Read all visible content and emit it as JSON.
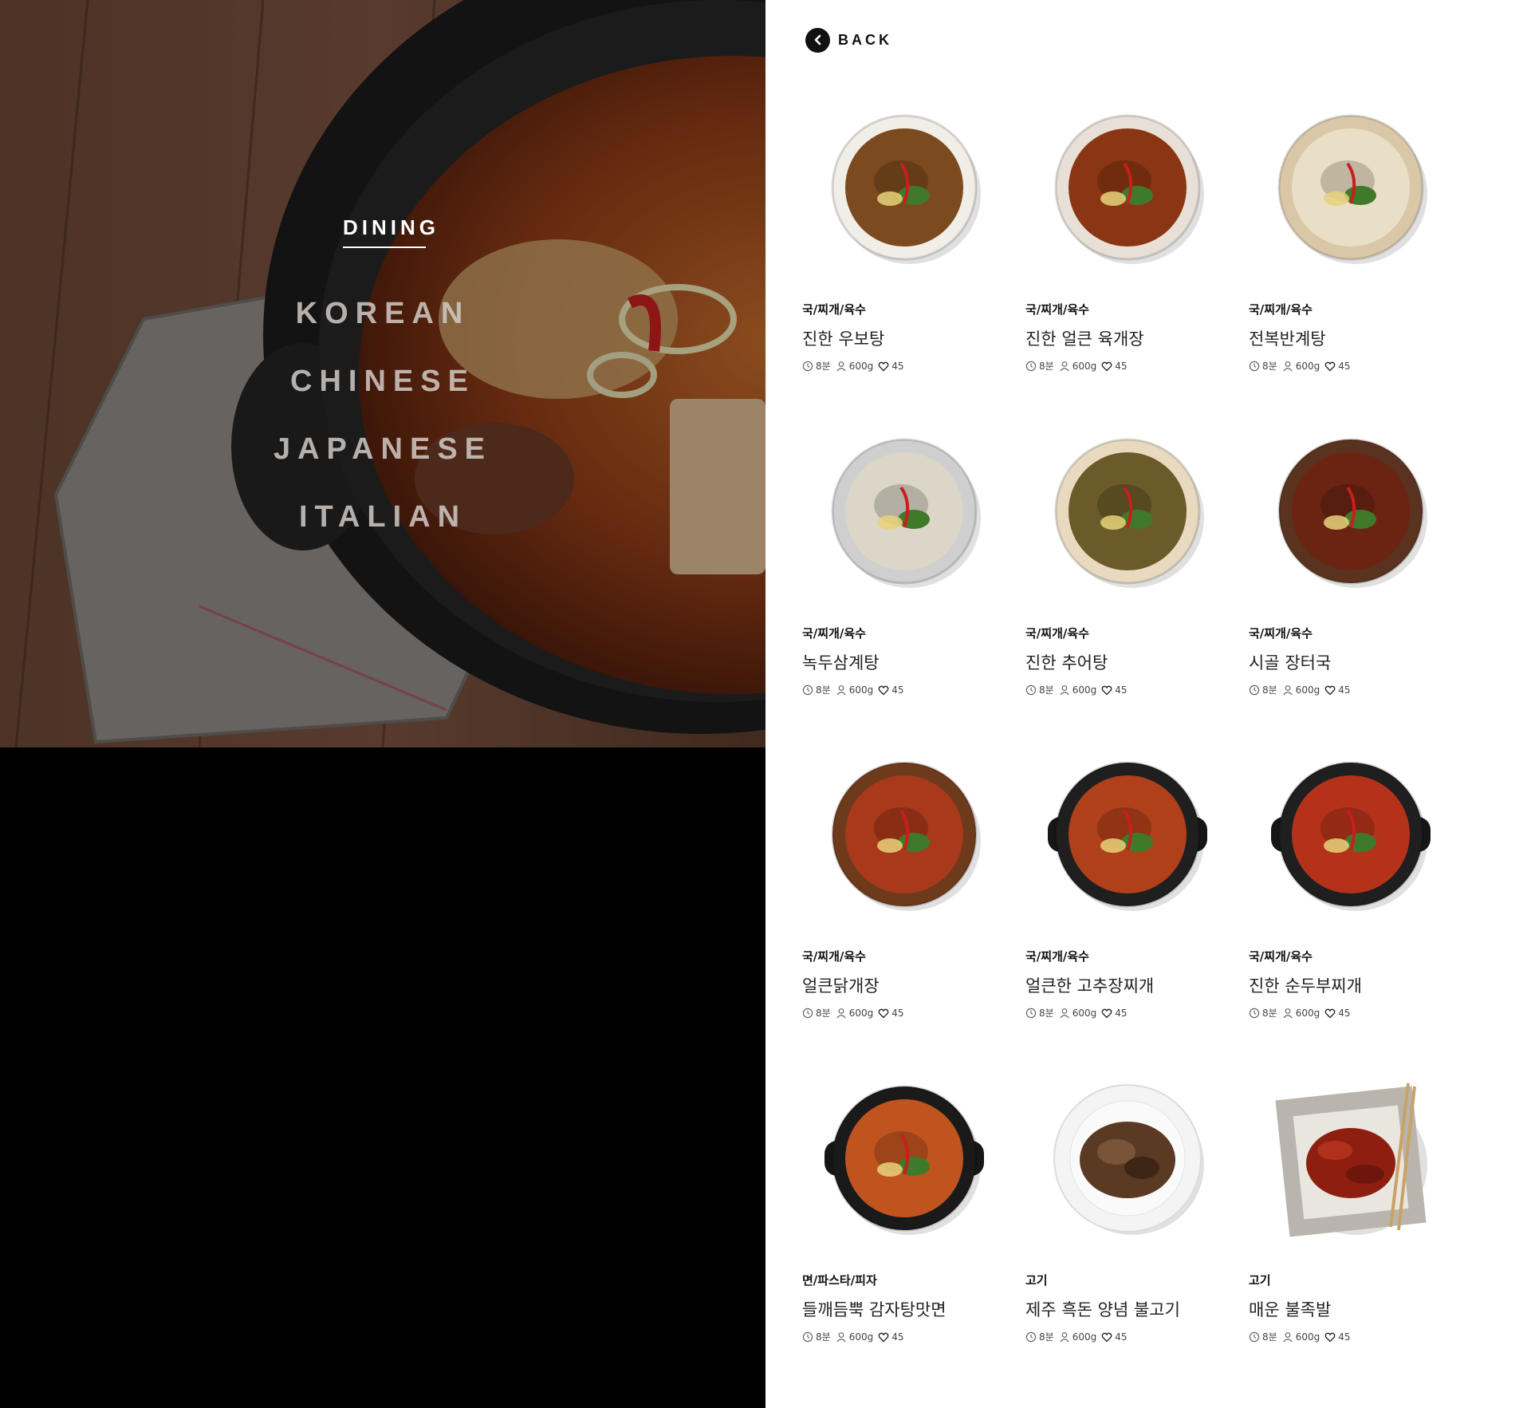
{
  "nav": {
    "title": "DINING",
    "items": [
      "KOREAN",
      "CHINESE",
      "JAPANESE",
      "ITALIAN"
    ]
  },
  "back": {
    "label": "BACK"
  },
  "dishes": [
    {
      "category": "국/찌개/육수",
      "name": "진한 우보탕",
      "time": "8분",
      "weight": "600g",
      "likes": "45",
      "plate": "#f1ede7",
      "soup": "#7b4a1e",
      "style": "ceramic"
    },
    {
      "category": "국/찌개/육수",
      "name": "진한 얼큰 육개장",
      "time": "8분",
      "weight": "600g",
      "likes": "45",
      "plate": "#e8e0d6",
      "soup": "#8a3614",
      "style": "ceramic"
    },
    {
      "category": "국/찌개/육수",
      "name": "전복반계탕",
      "time": "8분",
      "weight": "600g",
      "likes": "45",
      "plate": "#d9c7a8",
      "soup": "#e9dfc6",
      "style": "ceramic"
    },
    {
      "category": "국/찌개/육수",
      "name": "녹두삼계탕",
      "time": "8분",
      "weight": "600g",
      "likes": "45",
      "plate": "#cfcfcf",
      "soup": "#dcd6c8",
      "style": "ceramic"
    },
    {
      "category": "국/찌개/육수",
      "name": "진한 추어탕",
      "time": "8분",
      "weight": "600g",
      "likes": "45",
      "plate": "#e9d9bf",
      "soup": "#6b5a2a",
      "style": "ceramic"
    },
    {
      "category": "국/찌개/육수",
      "name": "시골 장터국",
      "time": "8분",
      "weight": "600g",
      "likes": "45",
      "plate": "#5a3320",
      "soup": "#6b2412",
      "style": "dark"
    },
    {
      "category": "국/찌개/육수",
      "name": "얼큰닭개장",
      "time": "8분",
      "weight": "600g",
      "likes": "45",
      "plate": "#6e3a1c",
      "soup": "#a8391a",
      "style": "dark"
    },
    {
      "category": "국/찌개/육수",
      "name": "얼큰한 고추장찌개",
      "time": "8분",
      "weight": "600g",
      "likes": "45",
      "plate": "#1f1f1f",
      "soup": "#b0401a",
      "style": "pot"
    },
    {
      "category": "국/찌개/육수",
      "name": "진한 순두부찌개",
      "time": "8분",
      "weight": "600g",
      "likes": "45",
      "plate": "#1f1f1f",
      "soup": "#b5321a",
      "style": "pot"
    },
    {
      "category": "면/파스타/피자",
      "name": "들깨듬뿍 감자탕맛면",
      "time": "8분",
      "weight": "600g",
      "likes": "45",
      "plate": "#1a1a1a",
      "soup": "#c0541e",
      "style": "pot"
    },
    {
      "category": "고기",
      "name": "제주 흑돈 양념 불고기",
      "time": "8분",
      "weight": "600g",
      "likes": "45",
      "plate": "#f4f4f4",
      "soup": "#5b3a24",
      "style": "plate"
    },
    {
      "category": "고기",
      "name": "매운 불족발",
      "time": "8분",
      "weight": "600g",
      "likes": "45",
      "plate": "#b9b4ac",
      "soup": "#8e1f10",
      "style": "square"
    }
  ]
}
